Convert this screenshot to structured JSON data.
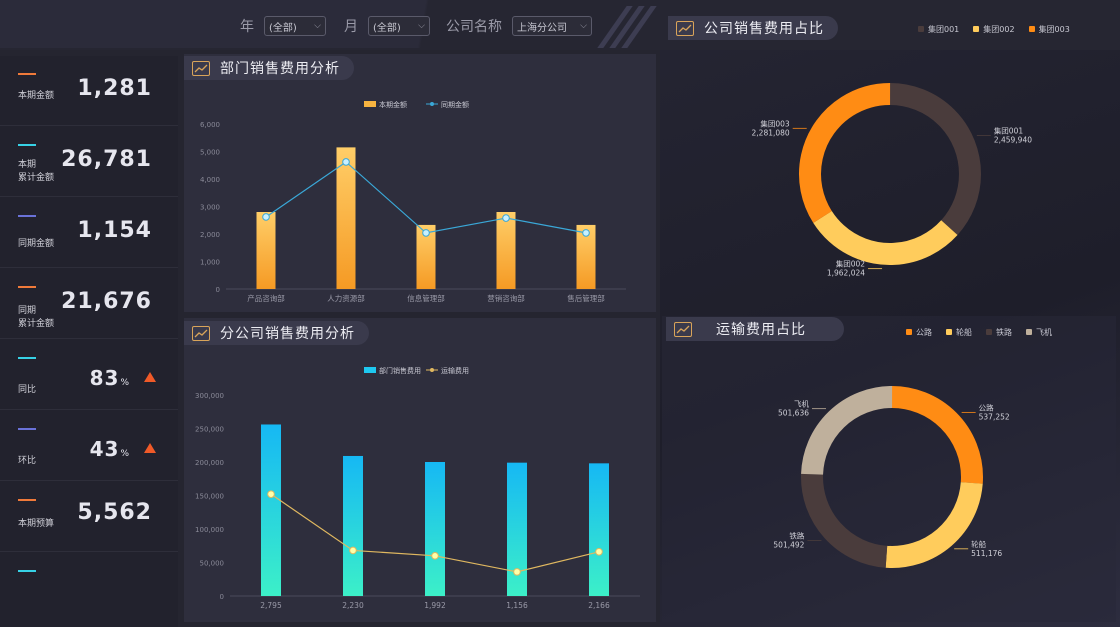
{
  "filters": {
    "year_label": "年",
    "year_value": "(全部)",
    "month_label": "月",
    "month_value": "(全部)",
    "company_label": "公司名称",
    "company_value": "上海分公司"
  },
  "kpis": [
    {
      "label1": "本期金额",
      "label2": "",
      "value": "1,281",
      "color": "#f07a3a"
    },
    {
      "label1": "本期",
      "label2": "累计金额",
      "value": "26,781",
      "color": "#37d2e6"
    },
    {
      "label1": "同期金额",
      "label2": "",
      "value": "1,154",
      "color": "#6a72d8"
    },
    {
      "label1": "同期",
      "label2": "累计金额",
      "value": "21,676",
      "color": "#f07a3a"
    },
    {
      "label1": "同比",
      "label2": "",
      "value": "83",
      "unit": "%",
      "color": "#37d2e6"
    },
    {
      "label1": "环比",
      "label2": "",
      "value": "43",
      "unit": "%",
      "color": "#6a72d8"
    },
    {
      "label1": "本期预算",
      "label2": "",
      "value": "5,562",
      "color": "#f07a3a"
    },
    {
      "label1": "",
      "label2": "",
      "value": "",
      "color": "#37d2e6"
    }
  ],
  "panels": {
    "dept": "部门销售费用分析",
    "branch": "分公司销售费用分析",
    "company": "公司销售费用占比",
    "transport": "运输费用占比"
  },
  "chart_data": [
    {
      "type": "bar",
      "title": "部门销售费用分析",
      "categories": [
        "产品咨询部",
        "人力资源部",
        "信息管理部",
        "营销咨询部",
        "售后管理部"
      ],
      "ylim": [
        0,
        6000
      ],
      "yticks": [
        "0",
        "1,000",
        "2,000",
        "3,000",
        "4,000",
        "5,000",
        "6,000"
      ],
      "series": [
        {
          "name": "本期金额",
          "type": "bar",
          "values": [
            2800,
            5150,
            2330,
            2800,
            2330
          ],
          "color": "#f7b440"
        },
        {
          "name": "同期金额",
          "type": "line",
          "values": [
            2620,
            4620,
            2040,
            2580,
            2040
          ],
          "color": "#3aa8d8"
        }
      ]
    },
    {
      "type": "bar",
      "title": "分公司销售费用分析",
      "categories": [
        "2,795",
        "2,230",
        "1,992",
        "1,156",
        "2,166"
      ],
      "ylim": [
        0,
        300000
      ],
      "yticks": [
        "0",
        "50,000",
        "100,000",
        "150,000",
        "200,000",
        "250,000",
        "300,000"
      ],
      "series": [
        {
          "name": "部门销售费用",
          "type": "bar",
          "values": [
            256000,
            209000,
            200000,
            199000,
            198000
          ],
          "color": "#1ec8f0"
        },
        {
          "name": "运输费用",
          "type": "line",
          "values": [
            152000,
            68000,
            60000,
            36000,
            66000
          ],
          "color": "#e0b860"
        }
      ]
    },
    {
      "type": "pie",
      "title": "公司销售费用占比",
      "legend": [
        "集团001",
        "集团002",
        "集团003"
      ],
      "labels": [
        "集团001",
        "集团002",
        "集团003"
      ],
      "value_labels": [
        "2,459,940",
        "1,962,024",
        "2,281,080"
      ],
      "values": [
        2459940,
        1962024,
        2281080
      ],
      "colors": [
        "#4a3c3c",
        "#ffcc5c",
        "#ff8c14"
      ]
    },
    {
      "type": "pie",
      "title": "运输费用占比",
      "legend": [
        "公路",
        "轮船",
        "铁路",
        "飞机"
      ],
      "labels": [
        "公路",
        "轮船",
        "铁路",
        "飞机"
      ],
      "value_labels": [
        "537,252",
        "511,176",
        "501,492",
        "501,636"
      ],
      "values": [
        537252,
        511176,
        501492,
        501636
      ],
      "colors": [
        "#ff8c14",
        "#ffcc5c",
        "#4a3c3c",
        "#bfb09c"
      ]
    }
  ]
}
